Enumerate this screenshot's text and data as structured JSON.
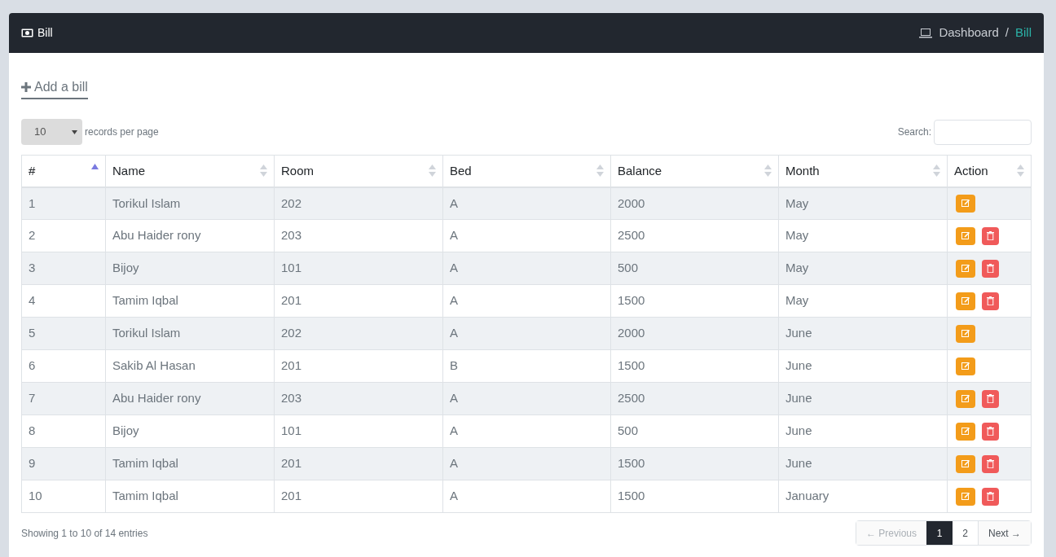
{
  "header": {
    "title": "Bill",
    "separator": "/",
    "breadcrumb": [
      {
        "label": "Dashboard",
        "current": false
      },
      {
        "label": "Bill",
        "current": true
      }
    ]
  },
  "add_link": {
    "label": "Add a bill"
  },
  "page_size": {
    "value": "10",
    "label": "records per page"
  },
  "search": {
    "label": "Search:"
  },
  "table": {
    "columns": [
      {
        "label": "#",
        "sorted": true
      },
      {
        "label": "Name",
        "sorted": false
      },
      {
        "label": "Room",
        "sorted": false
      },
      {
        "label": "Bed",
        "sorted": false
      },
      {
        "label": "Balance",
        "sorted": false
      },
      {
        "label": "Month",
        "sorted": false
      },
      {
        "label": "Action",
        "sorted": false
      }
    ],
    "rows": [
      {
        "cells": [
          "1",
          "Torikul Islam",
          "202",
          "A",
          "2000",
          "May"
        ],
        "deletable": false
      },
      {
        "cells": [
          "2",
          "Abu Haider rony",
          "203",
          "A",
          "2500",
          "May"
        ],
        "deletable": true
      },
      {
        "cells": [
          "3",
          "Bijoy",
          "101",
          "A",
          "500",
          "May"
        ],
        "deletable": true
      },
      {
        "cells": [
          "4",
          "Tamim Iqbal",
          "201",
          "A",
          "1500",
          "May"
        ],
        "deletable": true
      },
      {
        "cells": [
          "5",
          "Torikul Islam",
          "202",
          "A",
          "2000",
          "June"
        ],
        "deletable": false
      },
      {
        "cells": [
          "6",
          "Sakib Al Hasan",
          "201",
          "B",
          "1500",
          "June"
        ],
        "deletable": false
      },
      {
        "cells": [
          "7",
          "Abu Haider rony",
          "203",
          "A",
          "2500",
          "June"
        ],
        "deletable": true
      },
      {
        "cells": [
          "8",
          "Bijoy",
          "101",
          "A",
          "500",
          "June"
        ],
        "deletable": true
      },
      {
        "cells": [
          "9",
          "Tamim Iqbal",
          "201",
          "A",
          "1500",
          "June"
        ],
        "deletable": true
      },
      {
        "cells": [
          "10",
          "Tamim Iqbal",
          "201",
          "A",
          "1500",
          "January"
        ],
        "deletable": true
      }
    ]
  },
  "info": "Showing 1 to 10 of 14 entries",
  "pagination": {
    "previous": {
      "label": "← Previous",
      "disabled": true
    },
    "pages": [
      {
        "label": "1",
        "selected": true
      },
      {
        "label": "2",
        "selected": false
      }
    ],
    "next": {
      "label": "Next →",
      "disabled": false
    }
  }
}
